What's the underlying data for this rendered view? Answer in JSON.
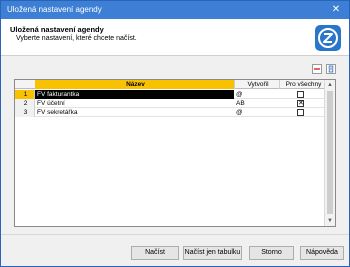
{
  "window": {
    "title": "Uložená nastavení agendy",
    "close_glyph": "✕"
  },
  "header": {
    "title": "Uložená nastavení agendy",
    "subtitle": "Vyberte nastavení, které chcete načíst.",
    "logo_icon": "pohoda-z-logo"
  },
  "toolbar": {
    "icons": [
      "delete-icon",
      "export-icon"
    ]
  },
  "grid": {
    "columns": [
      "",
      "Název",
      "Vytvořil",
      "Pro všechny"
    ],
    "rows": [
      {
        "num": "1",
        "name": "FV fakturantka",
        "created_by": "@",
        "for_all": false,
        "selected": true
      },
      {
        "num": "2",
        "name": "FV účetní",
        "created_by": "AB",
        "for_all": true,
        "selected": false
      },
      {
        "num": "3",
        "name": "FV sekretářka",
        "created_by": "@",
        "for_all": false,
        "selected": false
      }
    ]
  },
  "buttons": {
    "load": "Načíst",
    "load_table": "Načíst jen tabulku",
    "cancel": "Storno",
    "help": "Nápověda"
  },
  "colors": {
    "titlebar": "#3e7fd6",
    "header_highlight": "#f8c200",
    "selected_row": "#000000",
    "logo": "#2a76c9"
  }
}
